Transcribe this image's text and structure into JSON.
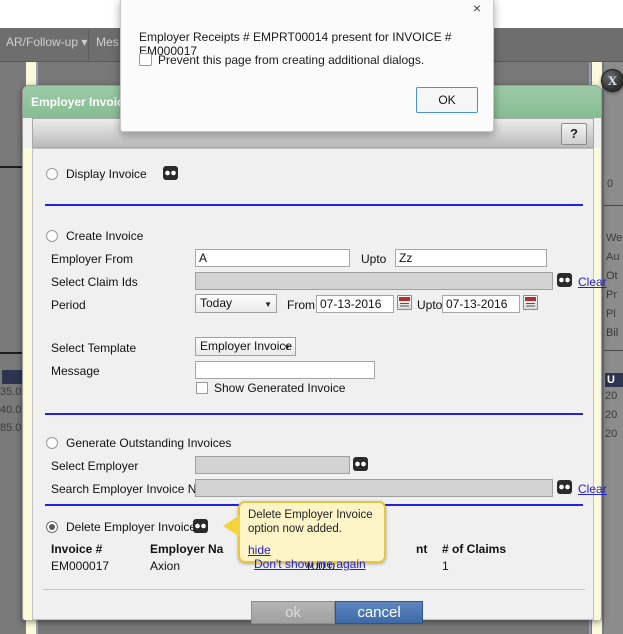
{
  "background": {
    "nav": [
      {
        "label": "AR/Follow-up ▾"
      },
      {
        "label": "Mes"
      }
    ],
    "left_values": [
      "35.0",
      "40.0",
      "85.0"
    ],
    "right_values": [
      "0",
      "We",
      "Au",
      "Ot",
      "Pr",
      "Pl",
      "Bil",
      "U",
      "20",
      "20",
      "20"
    ]
  },
  "js_dialog": {
    "message": "Employer Receipts # EMPRT00014 present for INVOICE # EM000017",
    "prevent_label": "Prevent this page from creating additional dialogs.",
    "ok_label": "OK",
    "close_icon": "×"
  },
  "modal": {
    "title": "Employer Invoice R",
    "close_icon": "X",
    "help_label": "?",
    "display_invoice": {
      "label": "Display Invoice",
      "selected": false
    },
    "create_invoice": {
      "label": "Create Invoice",
      "selected": false,
      "employer_from_label": "Employer From",
      "employer_from_value": "A",
      "upto_label": "Upto",
      "employer_upto_value": "Zz",
      "select_claim_ids_label": "Select Claim Ids",
      "select_claim_ids_value": "",
      "clear_label": "Clear",
      "period_label": "Period",
      "period_value": "Today",
      "from_label": "From",
      "from_value": "07-13-2016",
      "upto2_label": "Upto",
      "upto_value": "07-13-2016",
      "select_template_label": "Select Template",
      "select_template_value": "Employer Invoice",
      "message_label": "Message",
      "message_value": "",
      "show_generated_label": "Show Generated Invoice",
      "show_generated_checked": false
    },
    "generate_outstanding": {
      "label": "Generate Outstanding Invoices",
      "selected": false,
      "select_employer_label": "Select Employer",
      "select_employer_value": "",
      "search_nos_label": "Search Employer Invoice Nos",
      "search_nos_value": "",
      "clear_label": "Clear"
    },
    "delete_invoice": {
      "label": "Delete Employer Invoice",
      "selected": true,
      "table": {
        "columns": [
          "Invoice #",
          "Employer Na",
          "nt",
          "# of Claims"
        ],
        "rows": [
          {
            "invoice": "EM000017",
            "employer": "Axion",
            "amount": "100.0",
            "claims": "1"
          }
        ]
      }
    },
    "tooltip": {
      "text": "Delete Employer Invoice option now added.",
      "hide_label": "hide",
      "dont_show_label": "Don't show me again"
    },
    "footer": {
      "ok_label": "ok",
      "cancel_label": "cancel"
    }
  }
}
